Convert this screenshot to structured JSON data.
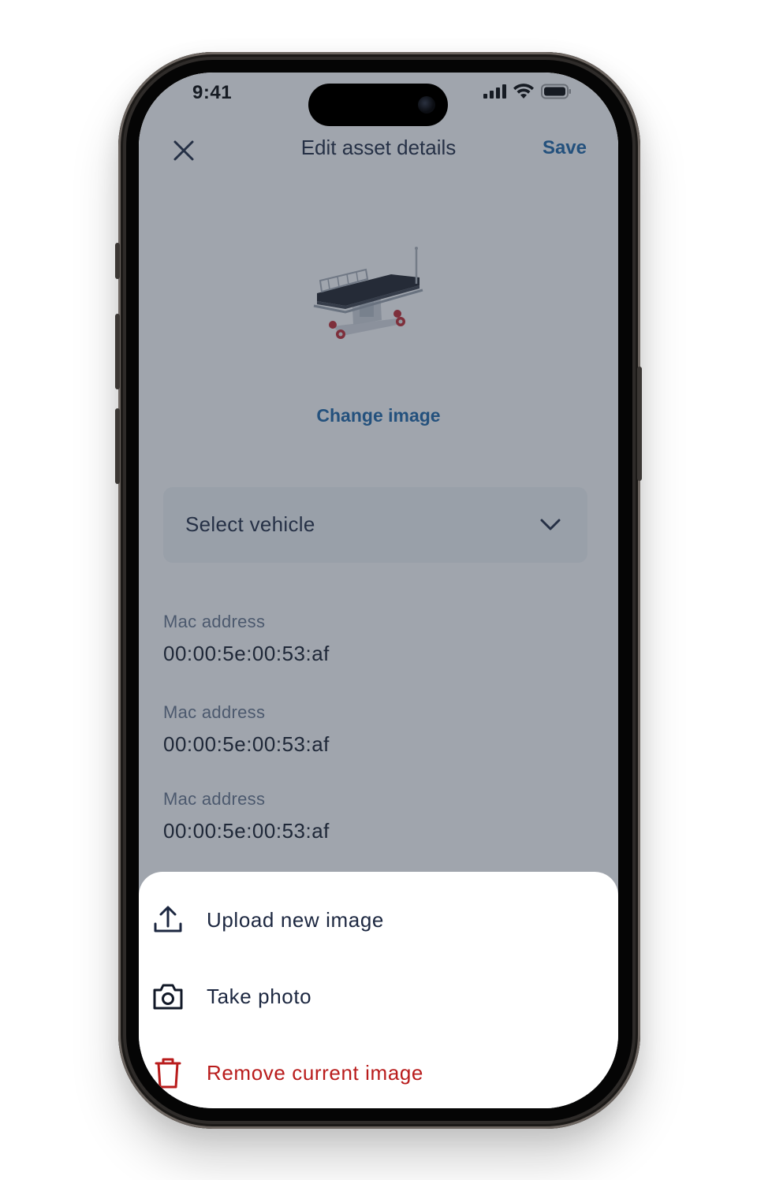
{
  "status_bar": {
    "time": "9:41"
  },
  "header": {
    "title": "Edit asset details",
    "save_label": "Save"
  },
  "asset": {
    "change_image_label": "Change image"
  },
  "vehicle_select": {
    "value": "Select vehicle"
  },
  "fields": [
    {
      "label": "Mac address",
      "value": "00:00:5e:00:53:af"
    },
    {
      "label": "Mac address",
      "value": "00:00:5e:00:53:af"
    },
    {
      "label": "Mac address",
      "value": "00:00:5e:00:53:af"
    }
  ],
  "sheet": {
    "items": [
      {
        "label": "Upload new image",
        "icon": "upload-icon"
      },
      {
        "label": "Take photo",
        "icon": "camera-icon"
      },
      {
        "label": "Remove current image",
        "icon": "trash-icon",
        "color": "#b91c1c"
      }
    ]
  },
  "colors": {
    "accent": "#1a64a6",
    "title": "#1c2740",
    "danger": "#b91c1c",
    "overlay": "#313a4d"
  }
}
